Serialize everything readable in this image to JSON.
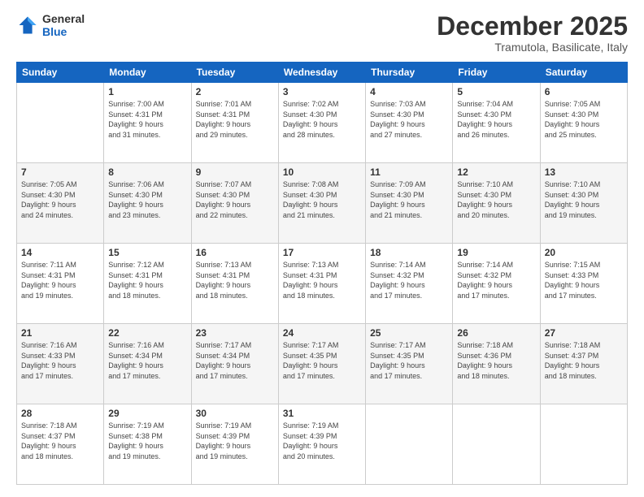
{
  "logo": {
    "general": "General",
    "blue": "Blue"
  },
  "header": {
    "month": "December 2025",
    "location": "Tramutola, Basilicate, Italy"
  },
  "weekdays": [
    "Sunday",
    "Monday",
    "Tuesday",
    "Wednesday",
    "Thursday",
    "Friday",
    "Saturday"
  ],
  "weeks": [
    [
      {
        "day": "",
        "info": ""
      },
      {
        "day": "1",
        "info": "Sunrise: 7:00 AM\nSunset: 4:31 PM\nDaylight: 9 hours\nand 31 minutes."
      },
      {
        "day": "2",
        "info": "Sunrise: 7:01 AM\nSunset: 4:31 PM\nDaylight: 9 hours\nand 29 minutes."
      },
      {
        "day": "3",
        "info": "Sunrise: 7:02 AM\nSunset: 4:30 PM\nDaylight: 9 hours\nand 28 minutes."
      },
      {
        "day": "4",
        "info": "Sunrise: 7:03 AM\nSunset: 4:30 PM\nDaylight: 9 hours\nand 27 minutes."
      },
      {
        "day": "5",
        "info": "Sunrise: 7:04 AM\nSunset: 4:30 PM\nDaylight: 9 hours\nand 26 minutes."
      },
      {
        "day": "6",
        "info": "Sunrise: 7:05 AM\nSunset: 4:30 PM\nDaylight: 9 hours\nand 25 minutes."
      }
    ],
    [
      {
        "day": "7",
        "info": "Sunrise: 7:05 AM\nSunset: 4:30 PM\nDaylight: 9 hours\nand 24 minutes."
      },
      {
        "day": "8",
        "info": "Sunrise: 7:06 AM\nSunset: 4:30 PM\nDaylight: 9 hours\nand 23 minutes."
      },
      {
        "day": "9",
        "info": "Sunrise: 7:07 AM\nSunset: 4:30 PM\nDaylight: 9 hours\nand 22 minutes."
      },
      {
        "day": "10",
        "info": "Sunrise: 7:08 AM\nSunset: 4:30 PM\nDaylight: 9 hours\nand 21 minutes."
      },
      {
        "day": "11",
        "info": "Sunrise: 7:09 AM\nSunset: 4:30 PM\nDaylight: 9 hours\nand 21 minutes."
      },
      {
        "day": "12",
        "info": "Sunrise: 7:10 AM\nSunset: 4:30 PM\nDaylight: 9 hours\nand 20 minutes."
      },
      {
        "day": "13",
        "info": "Sunrise: 7:10 AM\nSunset: 4:30 PM\nDaylight: 9 hours\nand 19 minutes."
      }
    ],
    [
      {
        "day": "14",
        "info": "Sunrise: 7:11 AM\nSunset: 4:31 PM\nDaylight: 9 hours\nand 19 minutes."
      },
      {
        "day": "15",
        "info": "Sunrise: 7:12 AM\nSunset: 4:31 PM\nDaylight: 9 hours\nand 18 minutes."
      },
      {
        "day": "16",
        "info": "Sunrise: 7:13 AM\nSunset: 4:31 PM\nDaylight: 9 hours\nand 18 minutes."
      },
      {
        "day": "17",
        "info": "Sunrise: 7:13 AM\nSunset: 4:31 PM\nDaylight: 9 hours\nand 18 minutes."
      },
      {
        "day": "18",
        "info": "Sunrise: 7:14 AM\nSunset: 4:32 PM\nDaylight: 9 hours\nand 17 minutes."
      },
      {
        "day": "19",
        "info": "Sunrise: 7:14 AM\nSunset: 4:32 PM\nDaylight: 9 hours\nand 17 minutes."
      },
      {
        "day": "20",
        "info": "Sunrise: 7:15 AM\nSunset: 4:33 PM\nDaylight: 9 hours\nand 17 minutes."
      }
    ],
    [
      {
        "day": "21",
        "info": "Sunrise: 7:16 AM\nSunset: 4:33 PM\nDaylight: 9 hours\nand 17 minutes."
      },
      {
        "day": "22",
        "info": "Sunrise: 7:16 AM\nSunset: 4:34 PM\nDaylight: 9 hours\nand 17 minutes."
      },
      {
        "day": "23",
        "info": "Sunrise: 7:17 AM\nSunset: 4:34 PM\nDaylight: 9 hours\nand 17 minutes."
      },
      {
        "day": "24",
        "info": "Sunrise: 7:17 AM\nSunset: 4:35 PM\nDaylight: 9 hours\nand 17 minutes."
      },
      {
        "day": "25",
        "info": "Sunrise: 7:17 AM\nSunset: 4:35 PM\nDaylight: 9 hours\nand 17 minutes."
      },
      {
        "day": "26",
        "info": "Sunrise: 7:18 AM\nSunset: 4:36 PM\nDaylight: 9 hours\nand 18 minutes."
      },
      {
        "day": "27",
        "info": "Sunrise: 7:18 AM\nSunset: 4:37 PM\nDaylight: 9 hours\nand 18 minutes."
      }
    ],
    [
      {
        "day": "28",
        "info": "Sunrise: 7:18 AM\nSunset: 4:37 PM\nDaylight: 9 hours\nand 18 minutes."
      },
      {
        "day": "29",
        "info": "Sunrise: 7:19 AM\nSunset: 4:38 PM\nDaylight: 9 hours\nand 19 minutes."
      },
      {
        "day": "30",
        "info": "Sunrise: 7:19 AM\nSunset: 4:39 PM\nDaylight: 9 hours\nand 19 minutes."
      },
      {
        "day": "31",
        "info": "Sunrise: 7:19 AM\nSunset: 4:39 PM\nDaylight: 9 hours\nand 20 minutes."
      },
      {
        "day": "",
        "info": ""
      },
      {
        "day": "",
        "info": ""
      },
      {
        "day": "",
        "info": ""
      }
    ]
  ]
}
